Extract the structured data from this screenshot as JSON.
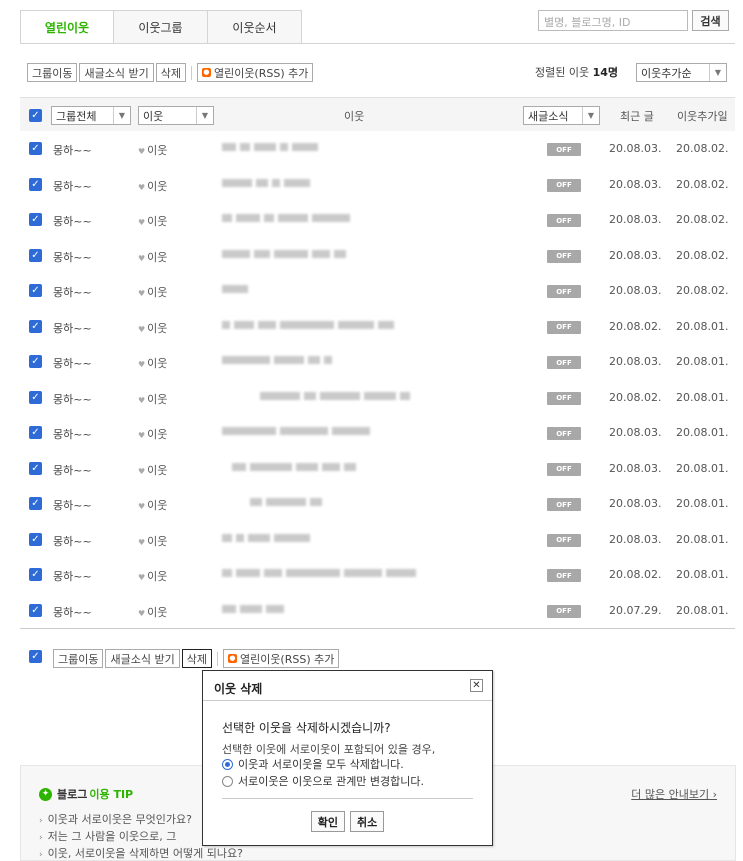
{
  "tabs": [
    {
      "label": "열린이웃",
      "active": true
    },
    {
      "label": "이웃그룹",
      "active": false
    },
    {
      "label": "이웃순서",
      "active": false
    }
  ],
  "search": {
    "placeholder": "별명, 블로그명, ID",
    "button": "검색"
  },
  "toolbar": {
    "move_group": "그룹이동",
    "receive_news": "새글소식 받기",
    "delete": "삭제",
    "rss_add": "열린이웃(RSS) 추가"
  },
  "sort": {
    "prefix": "정렬된 이웃 ",
    "count": "14명",
    "selected": "이웃추가순"
  },
  "header": {
    "group_select": "그룹전체",
    "neighbor_select": "이웃",
    "neighbor_col": "이웃",
    "news_select": "새글소식",
    "recent_col": "최근 글",
    "added_col": "이웃추가일"
  },
  "rows": [
    {
      "group": "몽하~~",
      "type": "이웃",
      "news": "OFF",
      "recent": "20.08.03.",
      "added": "20.08.02."
    },
    {
      "group": "몽하~~",
      "type": "이웃",
      "news": "OFF",
      "recent": "20.08.03.",
      "added": "20.08.02."
    },
    {
      "group": "몽하~~",
      "type": "이웃",
      "news": "OFF",
      "recent": "20.08.03.",
      "added": "20.08.02."
    },
    {
      "group": "몽하~~",
      "type": "이웃",
      "news": "OFF",
      "recent": "20.08.03.",
      "added": "20.08.02."
    },
    {
      "group": "몽하~~",
      "type": "이웃",
      "news": "OFF",
      "recent": "20.08.03.",
      "added": "20.08.02."
    },
    {
      "group": "몽하~~",
      "type": "이웃",
      "news": "OFF",
      "recent": "20.08.02.",
      "added": "20.08.01."
    },
    {
      "group": "몽하~~",
      "type": "이웃",
      "news": "OFF",
      "recent": "20.08.03.",
      "added": "20.08.01."
    },
    {
      "group": "몽하~~",
      "type": "이웃",
      "news": "OFF",
      "recent": "20.08.02.",
      "added": "20.08.01."
    },
    {
      "group": "몽하~~",
      "type": "이웃",
      "news": "OFF",
      "recent": "20.08.03.",
      "added": "20.08.01."
    },
    {
      "group": "몽하~~",
      "type": "이웃",
      "news": "OFF",
      "recent": "20.08.03.",
      "added": "20.08.01."
    },
    {
      "group": "몽하~~",
      "type": "이웃",
      "news": "OFF",
      "recent": "20.08.03.",
      "added": "20.08.01."
    },
    {
      "group": "몽하~~",
      "type": "이웃",
      "news": "OFF",
      "recent": "20.08.03.",
      "added": "20.08.01."
    },
    {
      "group": "몽하~~",
      "type": "이웃",
      "news": "OFF",
      "recent": "20.08.02.",
      "added": "20.08.01."
    },
    {
      "group": "몽하~~",
      "type": "이웃",
      "news": "OFF",
      "recent": "20.07.29.",
      "added": "20.08.01."
    }
  ],
  "tip": {
    "brand": "블로그",
    "title": "이용 TIP",
    "more": "더 많은 안내보기",
    "items": [
      "이웃과 서로이웃은 무엇인가요?",
      "저는 그 사람을 이웃으로, 그",
      "이웃, 서로이웃을 삭제하면 어떻게 되나요?"
    ]
  },
  "dialog": {
    "title": "이웃 삭제",
    "question": "선택한 이웃을 삭제하시겠습니까?",
    "sub": "선택한 이웃에 서로이웃이 포함되어 있을 경우,",
    "option1": "이웃과 서로이웃을 모두 삭제합니다.",
    "option2": "서로이웃은 이웃으로 관계만 변경합니다.",
    "confirm": "확인",
    "cancel": "취소"
  },
  "colors": {
    "accent": "#2db400",
    "checkbox": "#2e6bd6",
    "off_badge": "#a8a8a8",
    "rss": "#ff6600"
  }
}
